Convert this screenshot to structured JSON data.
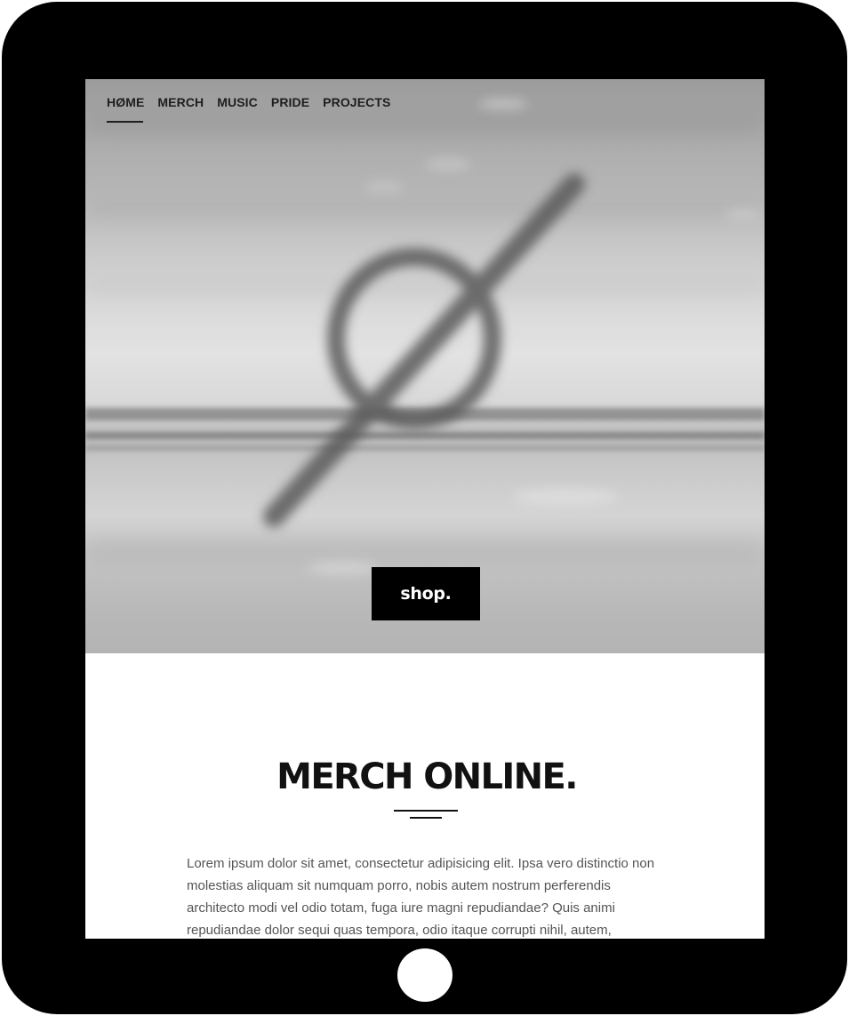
{
  "nav": {
    "items": [
      {
        "label": "HØME"
      },
      {
        "label": "MERCH"
      },
      {
        "label": "MUSIC"
      },
      {
        "label": "PRIDE"
      },
      {
        "label": "PROJECTS"
      }
    ],
    "active_index": 0
  },
  "hero": {
    "button_label": "shop."
  },
  "content": {
    "title": "MERCH ONLINE.",
    "body": "Lorem ipsum dolor sit amet, consectetur adipisicing elit. Ipsa vero distinctio non molestias aliquam sit numquam porro, nobis autem nostrum perferendis architecto modi vel odio totam, fuga iure magni repudiandae? Quis animi repudiandae dolor sequi quas tempora, odio itaque corrupti nihil, autem,"
  },
  "colors": {
    "device_frame": "#000000",
    "button_bg": "#000000",
    "button_text": "#ffffff",
    "title": "#111111",
    "body_text": "#555555"
  },
  "icons": {
    "hero_graphic": "blurred-slashed-o-logo-icon",
    "home_button": "device-home-button-icon"
  }
}
